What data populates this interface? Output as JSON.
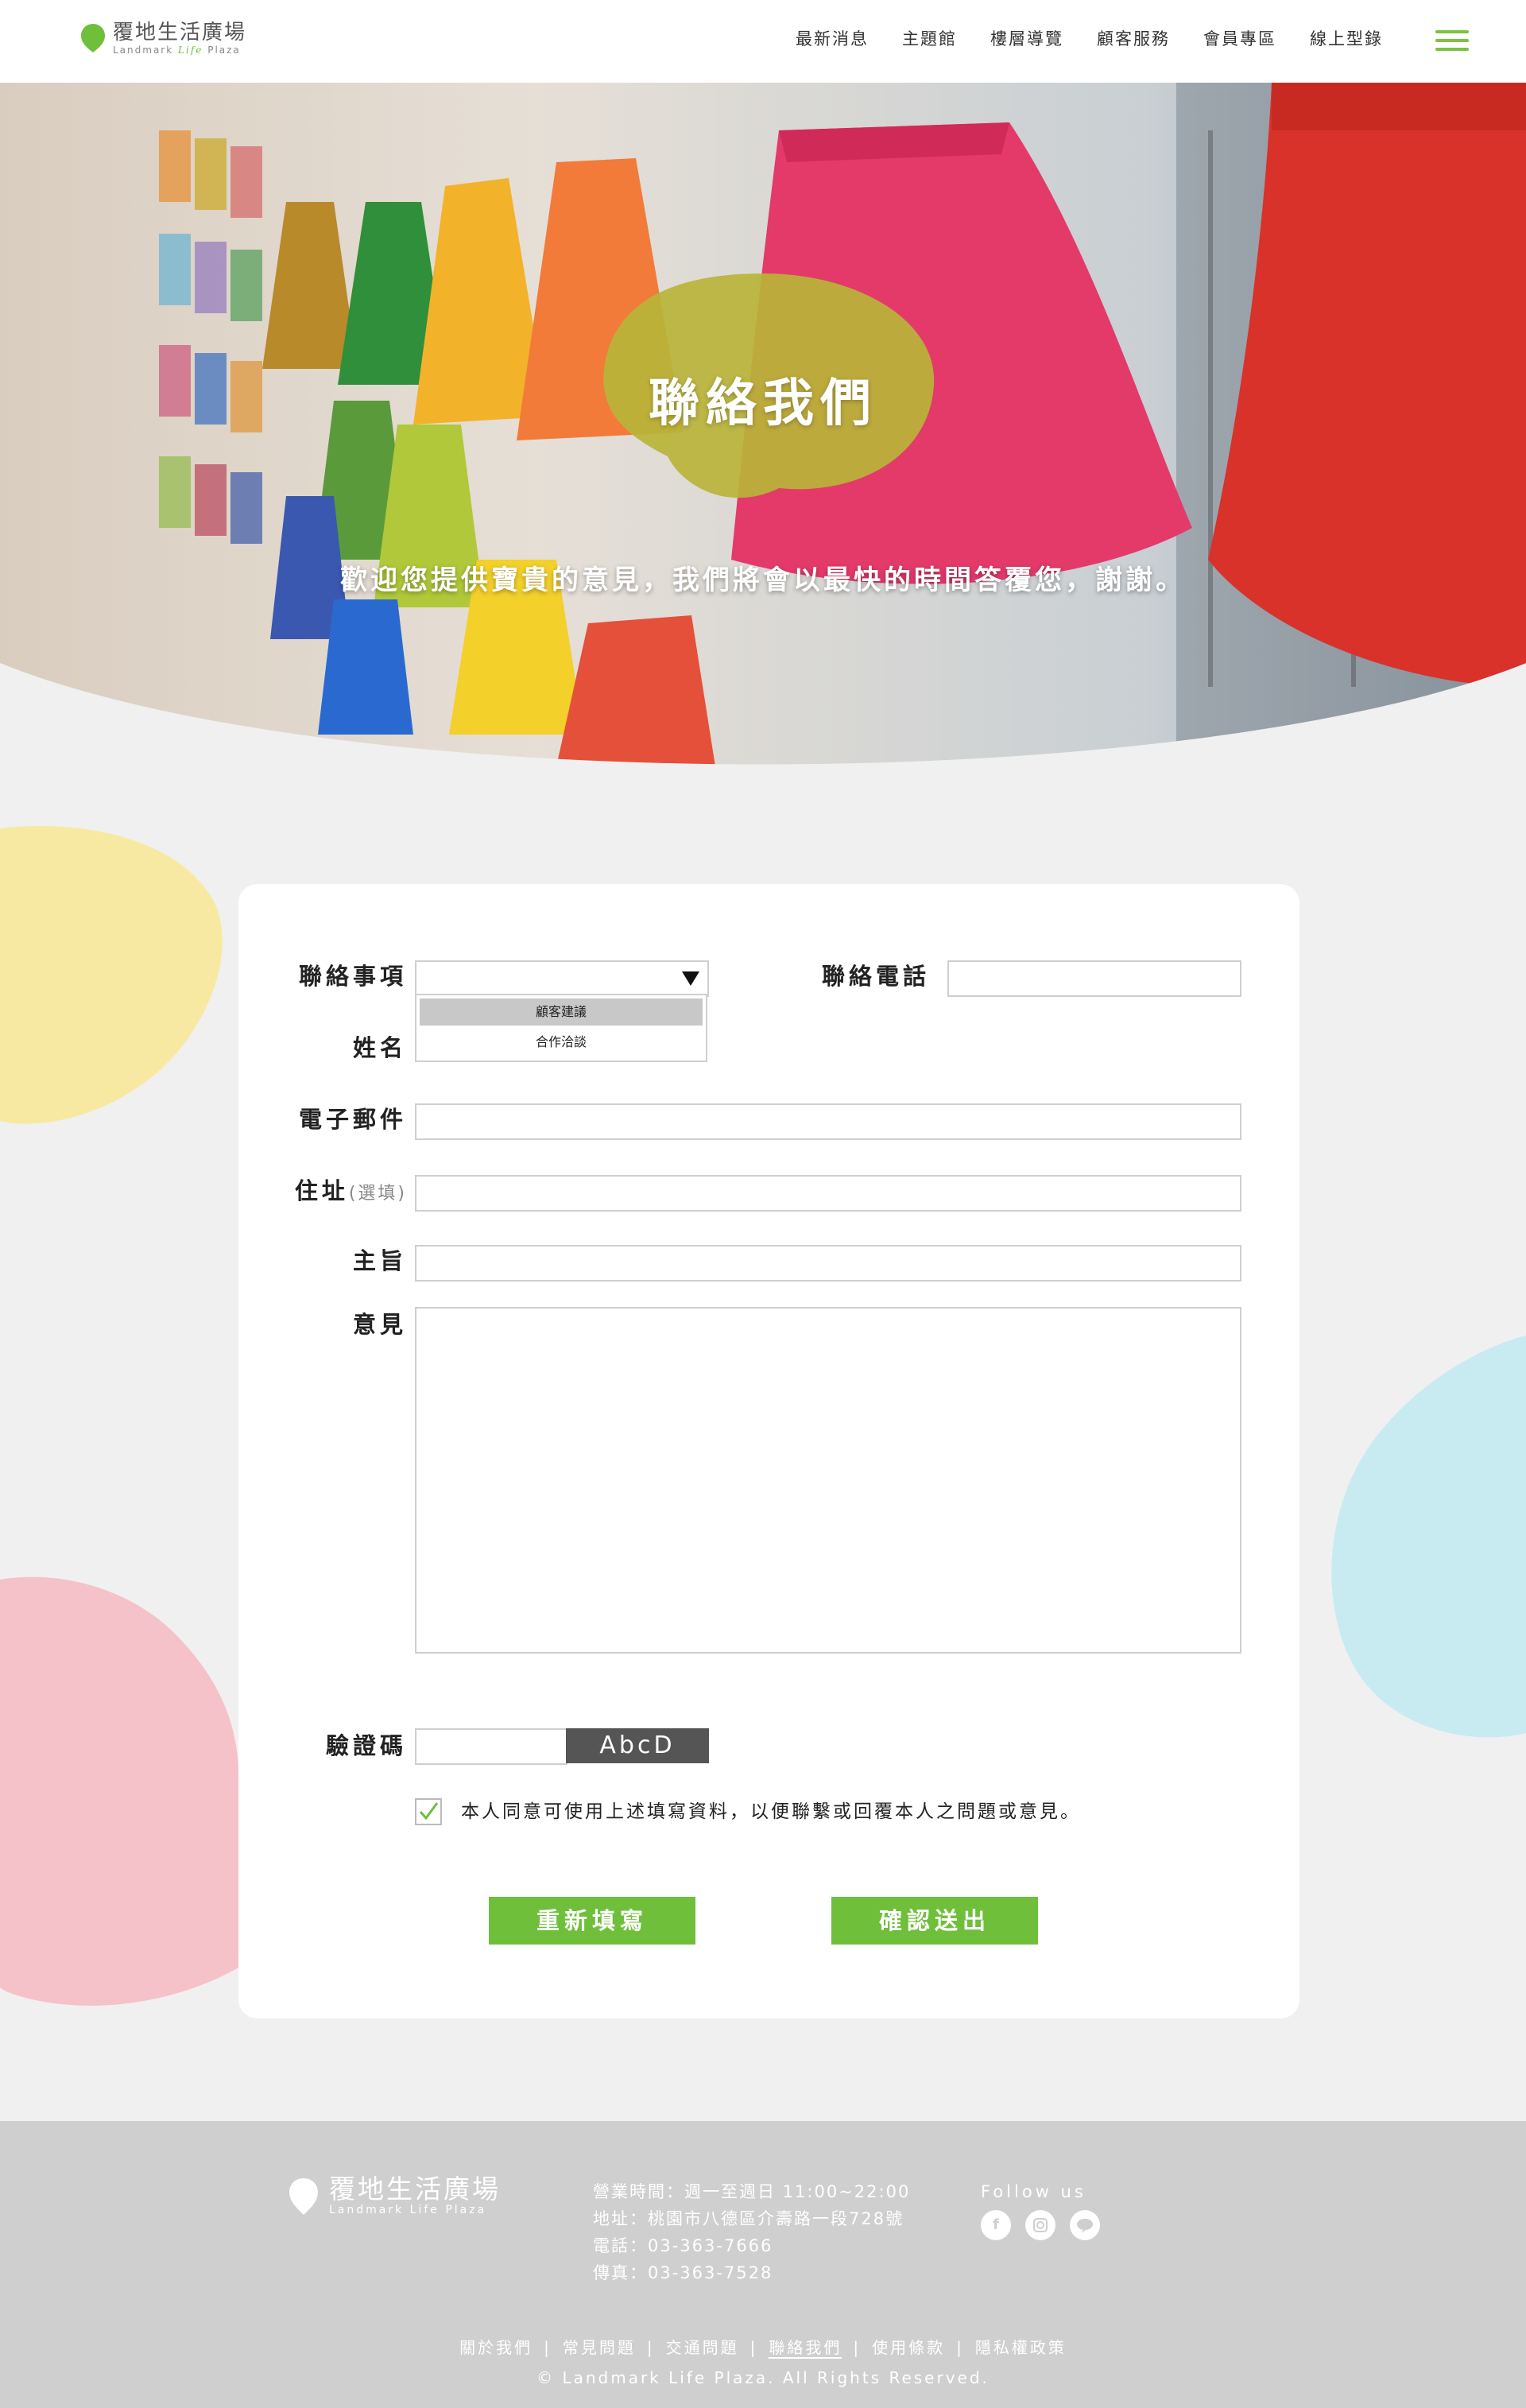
{
  "brand": {
    "name_cn": "覆地生活廣場",
    "name_en_pre": "Landmark",
    "name_en_life": "Life",
    "name_en_post": "Plaza",
    "accent": "#6fbf3b"
  },
  "nav": [
    "最新消息",
    "主題館",
    "樓層導覽",
    "顧客服務",
    "會員專區",
    "線上型錄"
  ],
  "hero": {
    "title": "聯絡我們",
    "subtitle": "歡迎您提供寶貴的意見，我們將會以最快的時間答覆您，謝謝。"
  },
  "form": {
    "labels": {
      "category": "聯絡事項",
      "phone": "聯絡電話",
      "name": "姓名",
      "email": "電子郵件",
      "address": "住址",
      "address_optional": "(選填)",
      "subject": "主旨",
      "opinion": "意見",
      "captcha": "驗證碼"
    },
    "category_options": [
      "顧客建議",
      "合作洽談"
    ],
    "captcha_code": "AbcD",
    "consent_checked": true,
    "consent_text": "本人同意可使用上述填寫資料，以便聯繫或回覆本人之問題或意見。",
    "reset_label": "重新填寫",
    "submit_label": "確認送出"
  },
  "footer": {
    "logo_cn": "覆地生活廣場",
    "logo_en": "Landmark Life Plaza",
    "info": [
      "營業時間：週一至週日 11:00~22:00",
      "地址：桃園市八德區介壽路一段728號",
      "電話：03-363-7666",
      "傳真：03-363-7528"
    ],
    "follow": "Follow us",
    "social": [
      "facebook-icon",
      "instagram-icon",
      "line-icon"
    ],
    "links": [
      "關於我們",
      "常見問題",
      "交通問題",
      "聯絡我們",
      "使用條款",
      "隱私權政策"
    ],
    "active_link": "聯絡我們",
    "copyright": "© Landmark Life Plaza. All Rights Reserved."
  }
}
